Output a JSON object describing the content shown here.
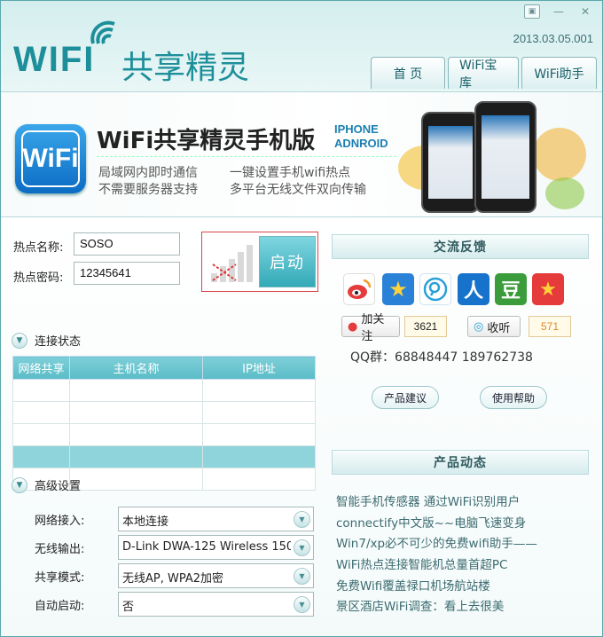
{
  "window": {
    "logo_wifi": "WIFI",
    "logo_cn": "共享精灵",
    "version": "2013.03.05.001",
    "controls": [
      "▣",
      "—",
      "✕"
    ],
    "tabs": [
      {
        "label": "首 页"
      },
      {
        "label": "WiFi宝库"
      },
      {
        "label": "WiFi助手"
      }
    ]
  },
  "banner": {
    "icon_text": "WiFi",
    "title": "WiFi共享精灵手机版",
    "sub1": "IPHONE",
    "sub2": "ADNROID",
    "features": [
      "局域网内即时通信",
      "一键设置手机wifi热点",
      "不需要服务器支持",
      "多平台无线文件双向传输"
    ]
  },
  "hotspot": {
    "name_label": "热点名称:",
    "name_value": "SOSO",
    "pwd_label": "热点密码:",
    "pwd_value": "12345641",
    "start_label": "启动"
  },
  "connection": {
    "title": "连接状态",
    "columns": [
      "网络共享",
      "主机名称",
      "IP地址"
    ],
    "rows": 5,
    "selected_row": 3
  },
  "advanced": {
    "title": "高级设置",
    "fields": [
      {
        "label": "网络接入:",
        "value": "本地连接"
      },
      {
        "label": "无线输出:",
        "value": "D-Link DWA-125 Wireless 150"
      },
      {
        "label": "共享模式:",
        "value": "无线AP, WPA2加密"
      },
      {
        "label": "自动启动:",
        "value": "否"
      }
    ]
  },
  "feedback": {
    "title": "交流反馈",
    "socials": [
      {
        "icon": "weibo-icon",
        "color": "#e43c3c"
      },
      {
        "icon": "qzone-star-icon",
        "color": "#2a82d8"
      },
      {
        "icon": "tencent-weibo-icon",
        "color": "#2aa0d8"
      },
      {
        "icon": "renren-icon",
        "color": "#1772cc"
      },
      {
        "icon": "douban-icon",
        "color": "#3a9c3a"
      },
      {
        "icon": "kaixin-icon",
        "color": "#e63b3b"
      }
    ],
    "follow_label": "加关注",
    "follow_count": "3621",
    "listen_label": "收听",
    "listen_count": "571",
    "qq_text": "QQ群：68848447 189762738",
    "suggest_label": "产品建议",
    "help_label": "使用帮助"
  },
  "news": {
    "title": "产品动态",
    "items": [
      "智能手机传感器 通过WiFi识别用户",
      "connectify中文版~~电脑飞速变身",
      "Win7/xp必不可少的免费wifi助手——",
      "WiFi热点连接智能机总量首超PC",
      "免费Wifi覆盖禄口机场航站楼",
      "景区酒店WiFi调查：看上去很美"
    ]
  }
}
